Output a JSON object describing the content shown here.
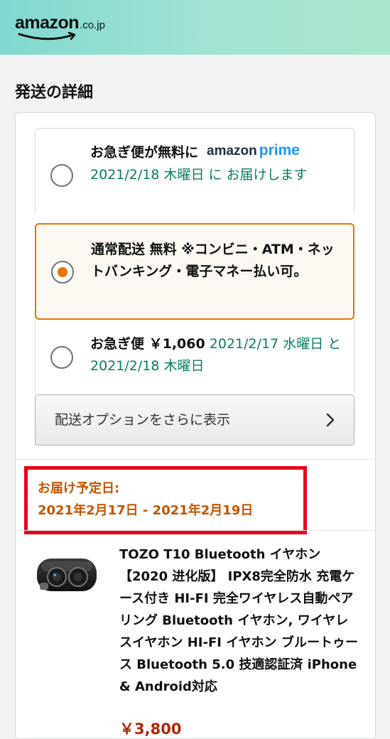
{
  "header": {
    "logo_text": "amazon",
    "logo_tld": ".co.jp"
  },
  "section_title": "発送の詳細",
  "shipping_options": [
    {
      "title": "お急ぎ便が無料に",
      "prime_badge_amazon": "amazon",
      "prime_badge_prime": "prime",
      "date_text": "2021/2/18 木曜日 に お届けします",
      "selected": false
    },
    {
      "title": "通常配送 無料 ※コンビニ・ATM・ネットバンキング・電子マネー払い可。",
      "selected": true
    },
    {
      "title": "お急ぎ便 ￥1,060",
      "date_text": "2021/2/17 水曜日 と 2021/2/18 木曜日",
      "selected": false
    }
  ],
  "more_options_label": "配送オプションをさらに表示",
  "delivery": {
    "label": "お届け予定日:",
    "range": "2021年2月17日 - 2021年2月19日"
  },
  "product": {
    "title": "TOZO T10 Bluetooth イヤホン 【2020 进化版】 IPX8完全防水 充電ケース付き HI-FI 完全ワイヤレス自動ペアリング Bluetooth イヤホン, ワイヤレスイヤホン HI-FI イヤホン ブルートゥース Bluetooth 5.0 技適認証済 iPhone & Android対応",
    "price": "￥3,800"
  },
  "colors": {
    "accent_orange": "#e77600",
    "delivery_text": "#c45500",
    "highlight_red": "#e8001f",
    "date_green": "#067d62",
    "prime_blue": "#1a98ff"
  },
  "icons": [
    "amazon-smile-logo",
    "radio-button",
    "chevron-right-icon",
    "earbuds-product-image"
  ]
}
